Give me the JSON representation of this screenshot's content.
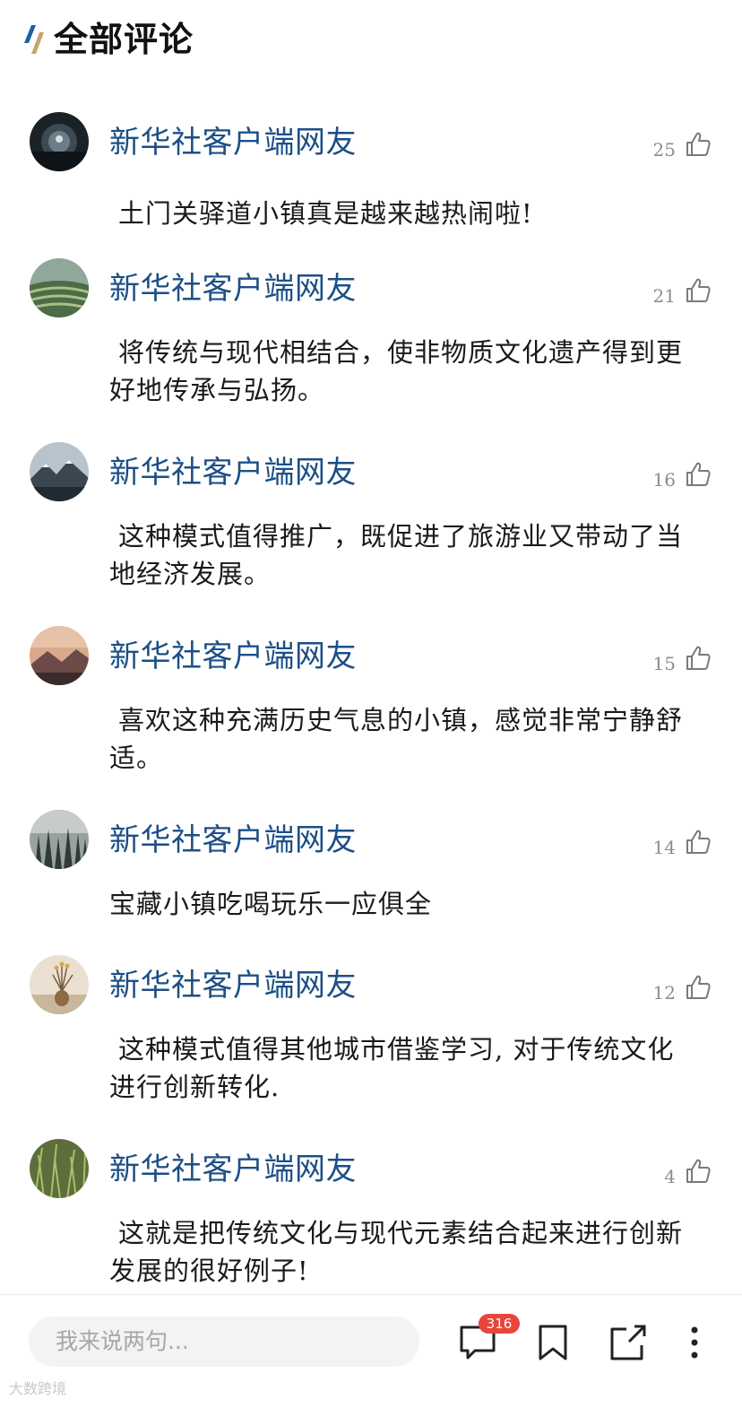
{
  "header": {
    "title": "全部评论",
    "logo_icon": "slash-logo-icon",
    "logo_colors": [
      "#1f5fa8",
      "#c9a36a"
    ]
  },
  "comments": [
    {
      "author": "新华社客户端网友",
      "likes": "25",
      "text": "土门关驿道小镇真是越来越热闹啦!",
      "avatar": "night-sky-avatar"
    },
    {
      "author": "新华社客户端网友",
      "likes": "21",
      "text": "将传统与现代相结合，使非物质文化遗产得到更好地传承与弘扬。",
      "avatar": "terrace-fields-avatar"
    },
    {
      "author": "新华社客户端网友",
      "likes": "16",
      "text": "这种模式值得推广，既促进了旅游业又带动了当地经济发展。",
      "avatar": "snow-mountain-avatar"
    },
    {
      "author": "新华社客户端网友",
      "likes": "15",
      "text": "喜欢这种充满历史气息的小镇，感觉非常宁静舒适。",
      "avatar": "sunset-mountain-avatar"
    },
    {
      "author": "新华社客户端网友",
      "likes": "14",
      "text": "宝藏小镇吃喝玩乐一应俱全",
      "avatar": "misty-forest-avatar"
    },
    {
      "author": "新华社客户端网友",
      "likes": "12",
      "text": "这种模式值得其他城市借鉴学习, 对于传统文化进行创新转化.",
      "avatar": "vase-flowers-avatar"
    },
    {
      "author": "新华社客户端网友",
      "likes": "4",
      "text": "这就是把传统文化与现代元素结合起来进行创新发展的很好例子!",
      "avatar": "grass-avatar"
    }
  ],
  "bottom_bar": {
    "input_placeholder": "我来说两句...",
    "comment_count": "316",
    "icons": [
      "comment-icon",
      "bookmark-icon",
      "share-icon",
      "more-icon"
    ],
    "badge_color": "#e8453c"
  },
  "watermark": "大数跨境",
  "colors": {
    "author": "#1c4f86",
    "like_count": "#8c8c8c",
    "text": "#1a1a1a"
  }
}
